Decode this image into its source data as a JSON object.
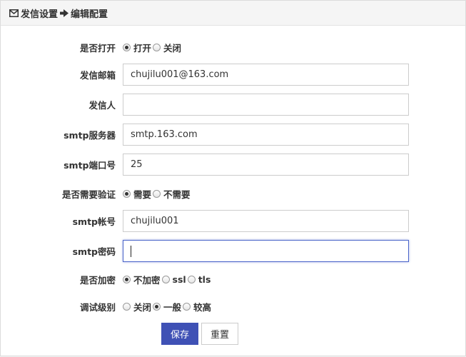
{
  "header": {
    "section": "发信设置",
    "page": "编辑配置"
  },
  "form": {
    "enabled": {
      "label": "是否打开",
      "options": [
        {
          "label": "打开",
          "checked": true
        },
        {
          "label": "关闭",
          "checked": false
        }
      ]
    },
    "sender_email": {
      "label": "发信邮箱",
      "value": "chujilu001@163.com"
    },
    "sender_name": {
      "label": "发信人",
      "value": ""
    },
    "smtp_server": {
      "label": "smtp服务器",
      "value": "smtp.163.com"
    },
    "smtp_port": {
      "label": "smtp端口号",
      "value": "25"
    },
    "auth_required": {
      "label": "是否需要验证",
      "options": [
        {
          "label": "需要",
          "checked": true
        },
        {
          "label": "不需要",
          "checked": false
        }
      ]
    },
    "smtp_account": {
      "label": "smtp帐号",
      "value": "chujilu001"
    },
    "smtp_password": {
      "label": "smtp密码",
      "value": ""
    },
    "encryption": {
      "label": "是否加密",
      "options": [
        {
          "label": "不加密",
          "checked": true
        },
        {
          "label": "ssl",
          "checked": false
        },
        {
          "label": "tls",
          "checked": false
        }
      ]
    },
    "debug_level": {
      "label": "调试级别",
      "options": [
        {
          "label": "关闭",
          "checked": false
        },
        {
          "label": "一般",
          "checked": true
        },
        {
          "label": "较高",
          "checked": false
        }
      ]
    }
  },
  "actions": {
    "save_label": "保存",
    "reset_label": "重置"
  },
  "colors": {
    "primary": "#3f51b5",
    "focus_border": "#4a64c9"
  }
}
